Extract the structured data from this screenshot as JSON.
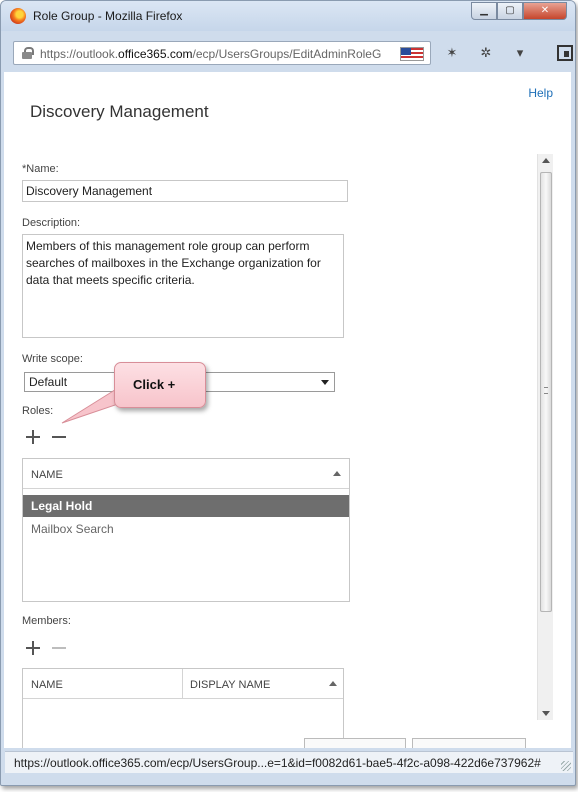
{
  "window": {
    "title": "Role Group - Mozilla Firefox",
    "minimize_glyph": "▁",
    "maximize_glyph": "▢",
    "close_glyph": "✕"
  },
  "browser": {
    "url_prefix": "https://outlook.",
    "url_domain": "office365.com",
    "url_suffix": "/ecp/UsersGroups/EditAdminRoleG",
    "status_url": "https://outlook.office365.com/ecp/UsersGroup...e=1&id=f0082d61-bae5-4f2c-a098-422d6e737962#",
    "nav_icons": [
      "plugin-icon",
      "bug-icon",
      "dropdown-icon",
      "panel-icon"
    ]
  },
  "page": {
    "help_link": "Help",
    "title": "Discovery Management"
  },
  "form": {
    "name_label": "*Name:",
    "name_value": "Discovery Management",
    "description_label": "Description:",
    "description_value": "Members of this management role group can perform searches of mailboxes in the Exchange organization for data that meets specific criteria.",
    "write_scope_label": "Write scope:",
    "write_scope_value": "Default",
    "roles_label": "Roles:",
    "members_label": "Members:"
  },
  "roles_table": {
    "header": "NAME",
    "rows": [
      {
        "name": "Legal Hold",
        "selected": true
      },
      {
        "name": "Mailbox Search",
        "selected": false
      }
    ]
  },
  "members_table": {
    "headers": [
      "NAME",
      "DISPLAY NAME"
    ]
  },
  "callout": {
    "text": "Click +"
  },
  "colors": {
    "link": "#1e6fb8",
    "selected_row": "#6e6e6e",
    "callout_fill": "#f7c4cb"
  }
}
